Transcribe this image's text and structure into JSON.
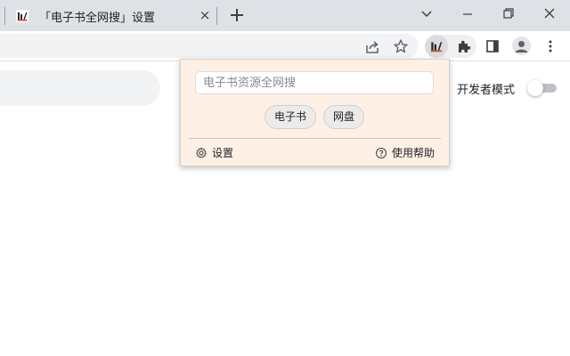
{
  "tabstrip": {
    "tab": {
      "title": "「电子书全网搜」设置",
      "favicon": "extension-logo-icon",
      "close": "×"
    },
    "new_tab_icon": "plus-icon",
    "window_controls": [
      "chevron-down-icon",
      "minimize-icon",
      "restore-icon",
      "close-icon"
    ]
  },
  "toolbar": {
    "icons": [
      "share-icon",
      "star-icon",
      "extension-logo-icon",
      "puzzle-icon",
      "side-panel-icon",
      "avatar-icon",
      "more-vert-icon"
    ]
  },
  "page": {
    "developer_mode_label": "开发者模式",
    "developer_mode_on": false
  },
  "popup": {
    "search_placeholder": "电子书资源全网搜",
    "search_value": "",
    "buttons": [
      "电子书",
      "网盘"
    ],
    "settings_label": "设置",
    "help_label": "使用帮助",
    "background_color": "#fff0e6"
  }
}
